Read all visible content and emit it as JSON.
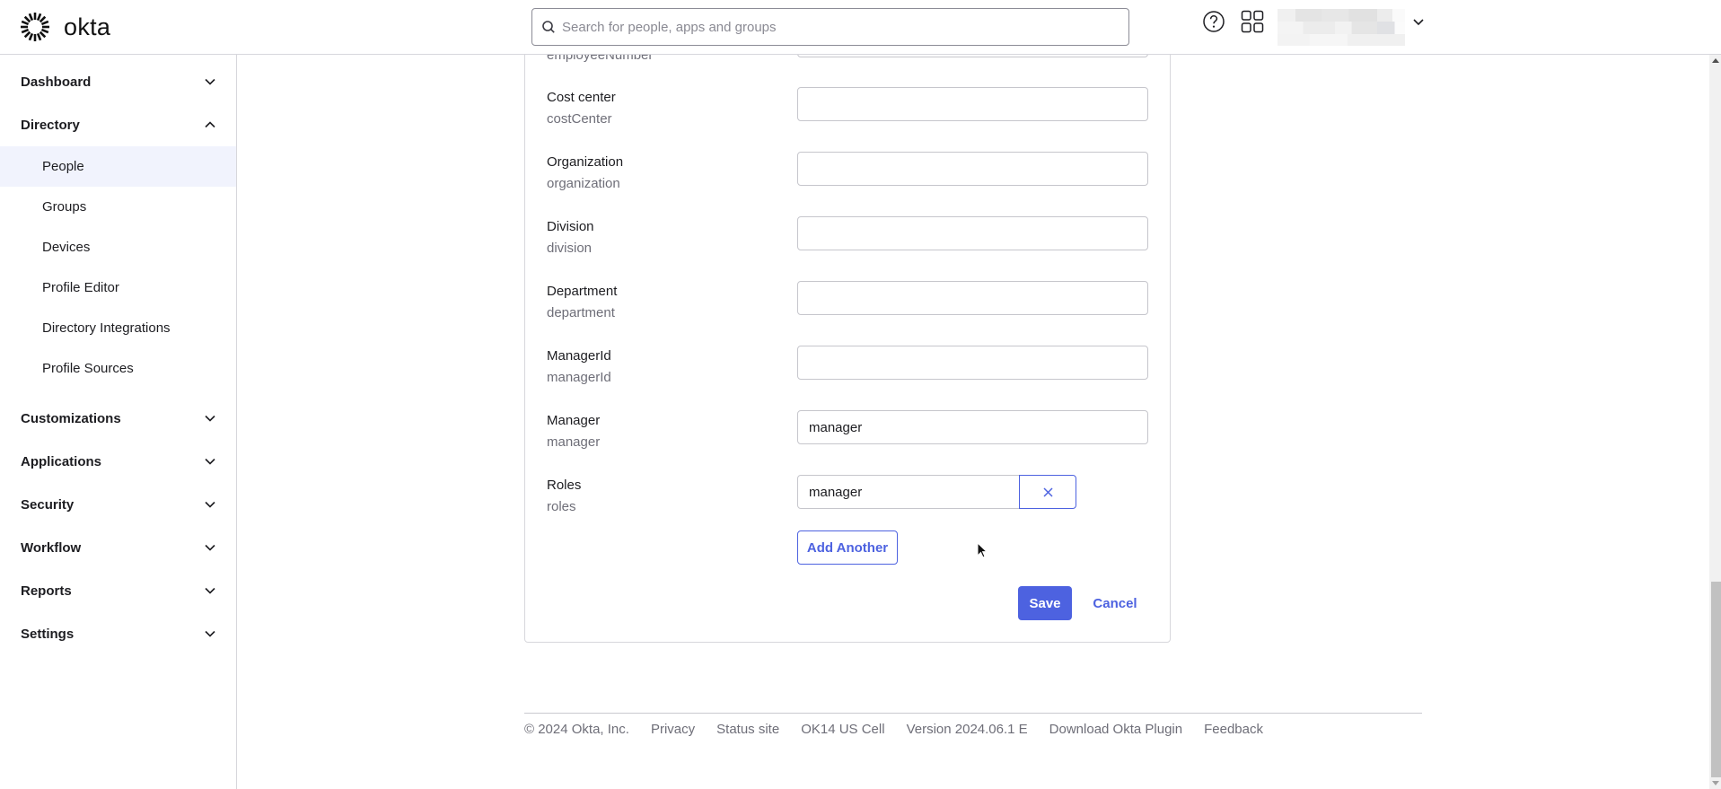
{
  "header": {
    "logo_text": "okta",
    "search": {
      "placeholder": "Search for people, apps and groups",
      "value": ""
    },
    "icons": [
      "sunburst-logo-icon",
      "search-icon",
      "help-icon",
      "apps-grid-icon",
      "chevron-down-icon"
    ],
    "user_name_blurred": true
  },
  "sidebar": {
    "sections": [
      {
        "label": "Dashboard",
        "expanded": false
      },
      {
        "label": "Directory",
        "expanded": true,
        "items": [
          {
            "label": "People",
            "active": true
          },
          {
            "label": "Groups",
            "active": false
          },
          {
            "label": "Devices",
            "active": false
          },
          {
            "label": "Profile Editor",
            "active": false
          },
          {
            "label": "Directory Integrations",
            "active": false
          },
          {
            "label": "Profile Sources",
            "active": false
          }
        ]
      },
      {
        "label": "Customizations",
        "expanded": false
      },
      {
        "label": "Applications",
        "expanded": false
      },
      {
        "label": "Security",
        "expanded": false
      },
      {
        "label": "Workflow",
        "expanded": false
      },
      {
        "label": "Reports",
        "expanded": false
      },
      {
        "label": "Settings",
        "expanded": false
      }
    ]
  },
  "form": {
    "partial_field": {
      "sublabel": "employeeNumber"
    },
    "fields": [
      {
        "label": "Cost center",
        "sublabel": "costCenter",
        "value": ""
      },
      {
        "label": "Organization",
        "sublabel": "organization",
        "value": ""
      },
      {
        "label": "Division",
        "sublabel": "division",
        "value": ""
      },
      {
        "label": "Department",
        "sublabel": "department",
        "value": ""
      },
      {
        "label": "ManagerId",
        "sublabel": "managerId",
        "value": ""
      },
      {
        "label": "Manager",
        "sublabel": "manager",
        "value": "manager"
      },
      {
        "label": "Roles",
        "sublabel": "roles",
        "value": "manager"
      }
    ],
    "add_another_label": "Add Another",
    "save_label": "Save",
    "cancel_label": "Cancel"
  },
  "footer": {
    "copyright": "© 2024 Okta, Inc.",
    "links": [
      "Privacy",
      "Status site",
      "OK14 US Cell",
      "Version 2024.06.1 E",
      "Download Okta Plugin",
      "Feedback"
    ]
  },
  "colors": {
    "accent": "#4d62e0",
    "active_nav_bg": "#f1f3fd",
    "border": "#d7d7dc",
    "muted_text": "#6e6e78"
  }
}
